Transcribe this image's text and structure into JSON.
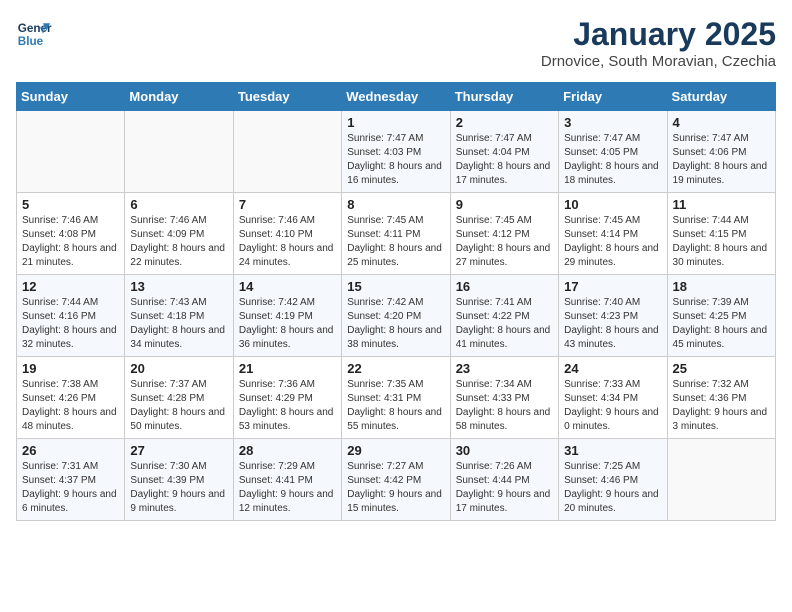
{
  "app": {
    "name_line1": "General",
    "name_line2": "Blue"
  },
  "calendar": {
    "title": "January 2025",
    "subtitle": "Drnovice, South Moravian, Czechia"
  },
  "weekdays": [
    "Sunday",
    "Monday",
    "Tuesday",
    "Wednesday",
    "Thursday",
    "Friday",
    "Saturday"
  ],
  "weeks": [
    [
      {
        "day": "",
        "sunrise": "",
        "sunset": "",
        "daylight": ""
      },
      {
        "day": "",
        "sunrise": "",
        "sunset": "",
        "daylight": ""
      },
      {
        "day": "",
        "sunrise": "",
        "sunset": "",
        "daylight": ""
      },
      {
        "day": "1",
        "sunrise": "Sunrise: 7:47 AM",
        "sunset": "Sunset: 4:03 PM",
        "daylight": "Daylight: 8 hours and 16 minutes."
      },
      {
        "day": "2",
        "sunrise": "Sunrise: 7:47 AM",
        "sunset": "Sunset: 4:04 PM",
        "daylight": "Daylight: 8 hours and 17 minutes."
      },
      {
        "day": "3",
        "sunrise": "Sunrise: 7:47 AM",
        "sunset": "Sunset: 4:05 PM",
        "daylight": "Daylight: 8 hours and 18 minutes."
      },
      {
        "day": "4",
        "sunrise": "Sunrise: 7:47 AM",
        "sunset": "Sunset: 4:06 PM",
        "daylight": "Daylight: 8 hours and 19 minutes."
      }
    ],
    [
      {
        "day": "5",
        "sunrise": "Sunrise: 7:46 AM",
        "sunset": "Sunset: 4:08 PM",
        "daylight": "Daylight: 8 hours and 21 minutes."
      },
      {
        "day": "6",
        "sunrise": "Sunrise: 7:46 AM",
        "sunset": "Sunset: 4:09 PM",
        "daylight": "Daylight: 8 hours and 22 minutes."
      },
      {
        "day": "7",
        "sunrise": "Sunrise: 7:46 AM",
        "sunset": "Sunset: 4:10 PM",
        "daylight": "Daylight: 8 hours and 24 minutes."
      },
      {
        "day": "8",
        "sunrise": "Sunrise: 7:45 AM",
        "sunset": "Sunset: 4:11 PM",
        "daylight": "Daylight: 8 hours and 25 minutes."
      },
      {
        "day": "9",
        "sunrise": "Sunrise: 7:45 AM",
        "sunset": "Sunset: 4:12 PM",
        "daylight": "Daylight: 8 hours and 27 minutes."
      },
      {
        "day": "10",
        "sunrise": "Sunrise: 7:45 AM",
        "sunset": "Sunset: 4:14 PM",
        "daylight": "Daylight: 8 hours and 29 minutes."
      },
      {
        "day": "11",
        "sunrise": "Sunrise: 7:44 AM",
        "sunset": "Sunset: 4:15 PM",
        "daylight": "Daylight: 8 hours and 30 minutes."
      }
    ],
    [
      {
        "day": "12",
        "sunrise": "Sunrise: 7:44 AM",
        "sunset": "Sunset: 4:16 PM",
        "daylight": "Daylight: 8 hours and 32 minutes."
      },
      {
        "day": "13",
        "sunrise": "Sunrise: 7:43 AM",
        "sunset": "Sunset: 4:18 PM",
        "daylight": "Daylight: 8 hours and 34 minutes."
      },
      {
        "day": "14",
        "sunrise": "Sunrise: 7:42 AM",
        "sunset": "Sunset: 4:19 PM",
        "daylight": "Daylight: 8 hours and 36 minutes."
      },
      {
        "day": "15",
        "sunrise": "Sunrise: 7:42 AM",
        "sunset": "Sunset: 4:20 PM",
        "daylight": "Daylight: 8 hours and 38 minutes."
      },
      {
        "day": "16",
        "sunrise": "Sunrise: 7:41 AM",
        "sunset": "Sunset: 4:22 PM",
        "daylight": "Daylight: 8 hours and 41 minutes."
      },
      {
        "day": "17",
        "sunrise": "Sunrise: 7:40 AM",
        "sunset": "Sunset: 4:23 PM",
        "daylight": "Daylight: 8 hours and 43 minutes."
      },
      {
        "day": "18",
        "sunrise": "Sunrise: 7:39 AM",
        "sunset": "Sunset: 4:25 PM",
        "daylight": "Daylight: 8 hours and 45 minutes."
      }
    ],
    [
      {
        "day": "19",
        "sunrise": "Sunrise: 7:38 AM",
        "sunset": "Sunset: 4:26 PM",
        "daylight": "Daylight: 8 hours and 48 minutes."
      },
      {
        "day": "20",
        "sunrise": "Sunrise: 7:37 AM",
        "sunset": "Sunset: 4:28 PM",
        "daylight": "Daylight: 8 hours and 50 minutes."
      },
      {
        "day": "21",
        "sunrise": "Sunrise: 7:36 AM",
        "sunset": "Sunset: 4:29 PM",
        "daylight": "Daylight: 8 hours and 53 minutes."
      },
      {
        "day": "22",
        "sunrise": "Sunrise: 7:35 AM",
        "sunset": "Sunset: 4:31 PM",
        "daylight": "Daylight: 8 hours and 55 minutes."
      },
      {
        "day": "23",
        "sunrise": "Sunrise: 7:34 AM",
        "sunset": "Sunset: 4:33 PM",
        "daylight": "Daylight: 8 hours and 58 minutes."
      },
      {
        "day": "24",
        "sunrise": "Sunrise: 7:33 AM",
        "sunset": "Sunset: 4:34 PM",
        "daylight": "Daylight: 9 hours and 0 minutes."
      },
      {
        "day": "25",
        "sunrise": "Sunrise: 7:32 AM",
        "sunset": "Sunset: 4:36 PM",
        "daylight": "Daylight: 9 hours and 3 minutes."
      }
    ],
    [
      {
        "day": "26",
        "sunrise": "Sunrise: 7:31 AM",
        "sunset": "Sunset: 4:37 PM",
        "daylight": "Daylight: 9 hours and 6 minutes."
      },
      {
        "day": "27",
        "sunrise": "Sunrise: 7:30 AM",
        "sunset": "Sunset: 4:39 PM",
        "daylight": "Daylight: 9 hours and 9 minutes."
      },
      {
        "day": "28",
        "sunrise": "Sunrise: 7:29 AM",
        "sunset": "Sunset: 4:41 PM",
        "daylight": "Daylight: 9 hours and 12 minutes."
      },
      {
        "day": "29",
        "sunrise": "Sunrise: 7:27 AM",
        "sunset": "Sunset: 4:42 PM",
        "daylight": "Daylight: 9 hours and 15 minutes."
      },
      {
        "day": "30",
        "sunrise": "Sunrise: 7:26 AM",
        "sunset": "Sunset: 4:44 PM",
        "daylight": "Daylight: 9 hours and 17 minutes."
      },
      {
        "day": "31",
        "sunrise": "Sunrise: 7:25 AM",
        "sunset": "Sunset: 4:46 PM",
        "daylight": "Daylight: 9 hours and 20 minutes."
      },
      {
        "day": "",
        "sunrise": "",
        "sunset": "",
        "daylight": ""
      }
    ]
  ]
}
